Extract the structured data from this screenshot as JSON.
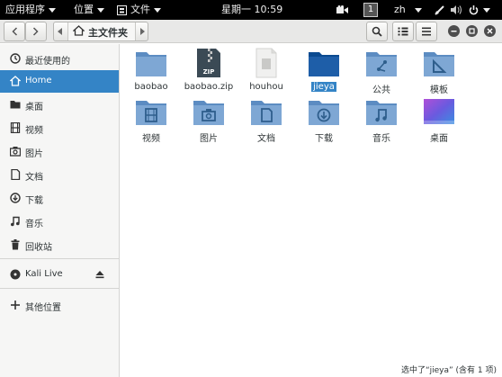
{
  "top_panel": {
    "applications": "应用程序",
    "places": "位置",
    "files_menu": "文件",
    "clock": "星期一 10:59",
    "workspace": "1",
    "language": "zh"
  },
  "toolbar": {
    "breadcrumb_home": "主文件夹"
  },
  "sidebar": {
    "items": [
      {
        "label": "最近使用的",
        "icon": "clock-icon"
      },
      {
        "label": "Home",
        "icon": "home-icon"
      },
      {
        "label": "桌面",
        "icon": "desktop-folder-icon"
      },
      {
        "label": "视频",
        "icon": "video-icon"
      },
      {
        "label": "图片",
        "icon": "camera-icon"
      },
      {
        "label": "文档",
        "icon": "document-icon"
      },
      {
        "label": "下载",
        "icon": "download-icon"
      },
      {
        "label": "音乐",
        "icon": "music-icon"
      },
      {
        "label": "回收站",
        "icon": "trash-icon"
      },
      {
        "label": "Kali Live",
        "icon": "disc-icon"
      },
      {
        "label": "其他位置",
        "icon": "plus-icon"
      }
    ]
  },
  "files": [
    {
      "name": "baobao",
      "icon": "folder-icon"
    },
    {
      "name": "baobao.zip",
      "icon": "zip-icon"
    },
    {
      "name": "houhou",
      "icon": "blank-file-icon"
    },
    {
      "name": "jieya",
      "icon": "folder-icon"
    },
    {
      "name": "公共",
      "icon": "shared-folder-icon"
    },
    {
      "name": "模板",
      "icon": "templates-folder-icon"
    },
    {
      "name": "视频",
      "icon": "videos-folder-icon"
    },
    {
      "name": "图片",
      "icon": "pictures-folder-icon"
    },
    {
      "name": "文档",
      "icon": "documents-folder-icon"
    },
    {
      "name": "下载",
      "icon": "downloads-folder-icon"
    },
    {
      "name": "音乐",
      "icon": "music-folder-icon"
    },
    {
      "name": "桌面",
      "icon": "desktop-icon"
    }
  ],
  "status": "选中了“jieya” (含有 1 项)",
  "colors": {
    "accent": "#3484c6",
    "folder": "#7ea7d4",
    "selected_folder": "#1e5ea8"
  }
}
